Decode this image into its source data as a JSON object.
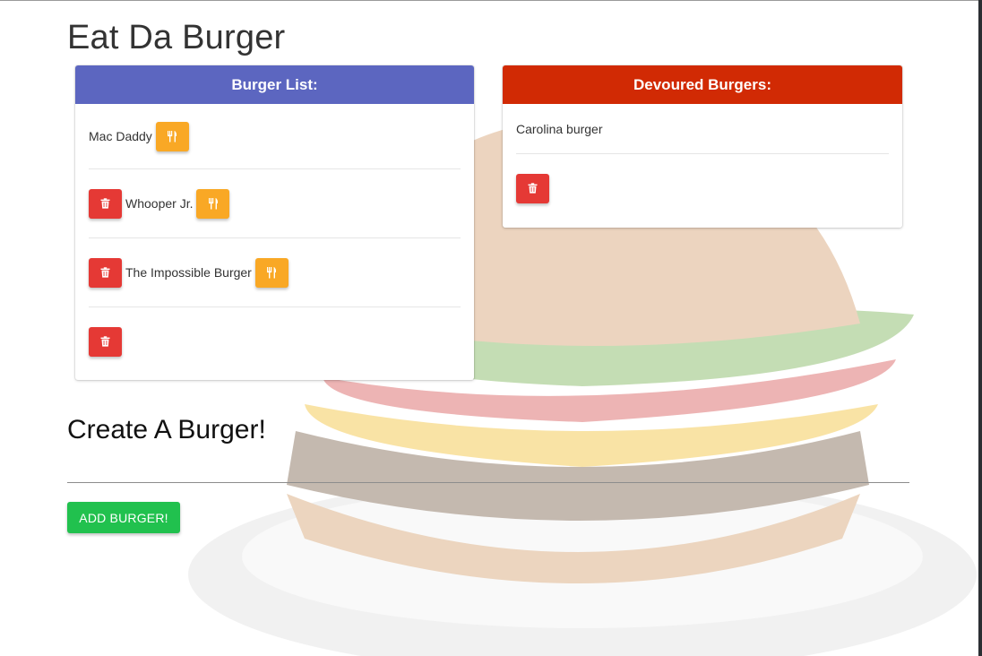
{
  "page": {
    "title": "Eat Da Burger"
  },
  "burger_list": {
    "header": "Burger List:",
    "header_color": "#5c66c0",
    "items": [
      {
        "name": "Mac Daddy",
        "delete": false,
        "devour": true
      },
      {
        "name": "Whooper Jr.",
        "delete": true,
        "devour": true
      },
      {
        "name": "The Impossible Burger",
        "delete": true,
        "devour": true
      },
      {
        "name": "",
        "delete": true,
        "devour": false
      }
    ]
  },
  "devoured": {
    "header": "Devoured Burgers:",
    "header_color": "#d12a04",
    "items": [
      {
        "name": "Carolina burger"
      }
    ]
  },
  "create": {
    "title": "Create A Burger!",
    "button_label": "ADD BURGER!"
  },
  "icons": {
    "delete": "trash-icon",
    "devour": "utensils-icon"
  },
  "colors": {
    "delete_button": "#e53935",
    "devour_button": "#f9a825",
    "add_button": "#21c14e"
  }
}
